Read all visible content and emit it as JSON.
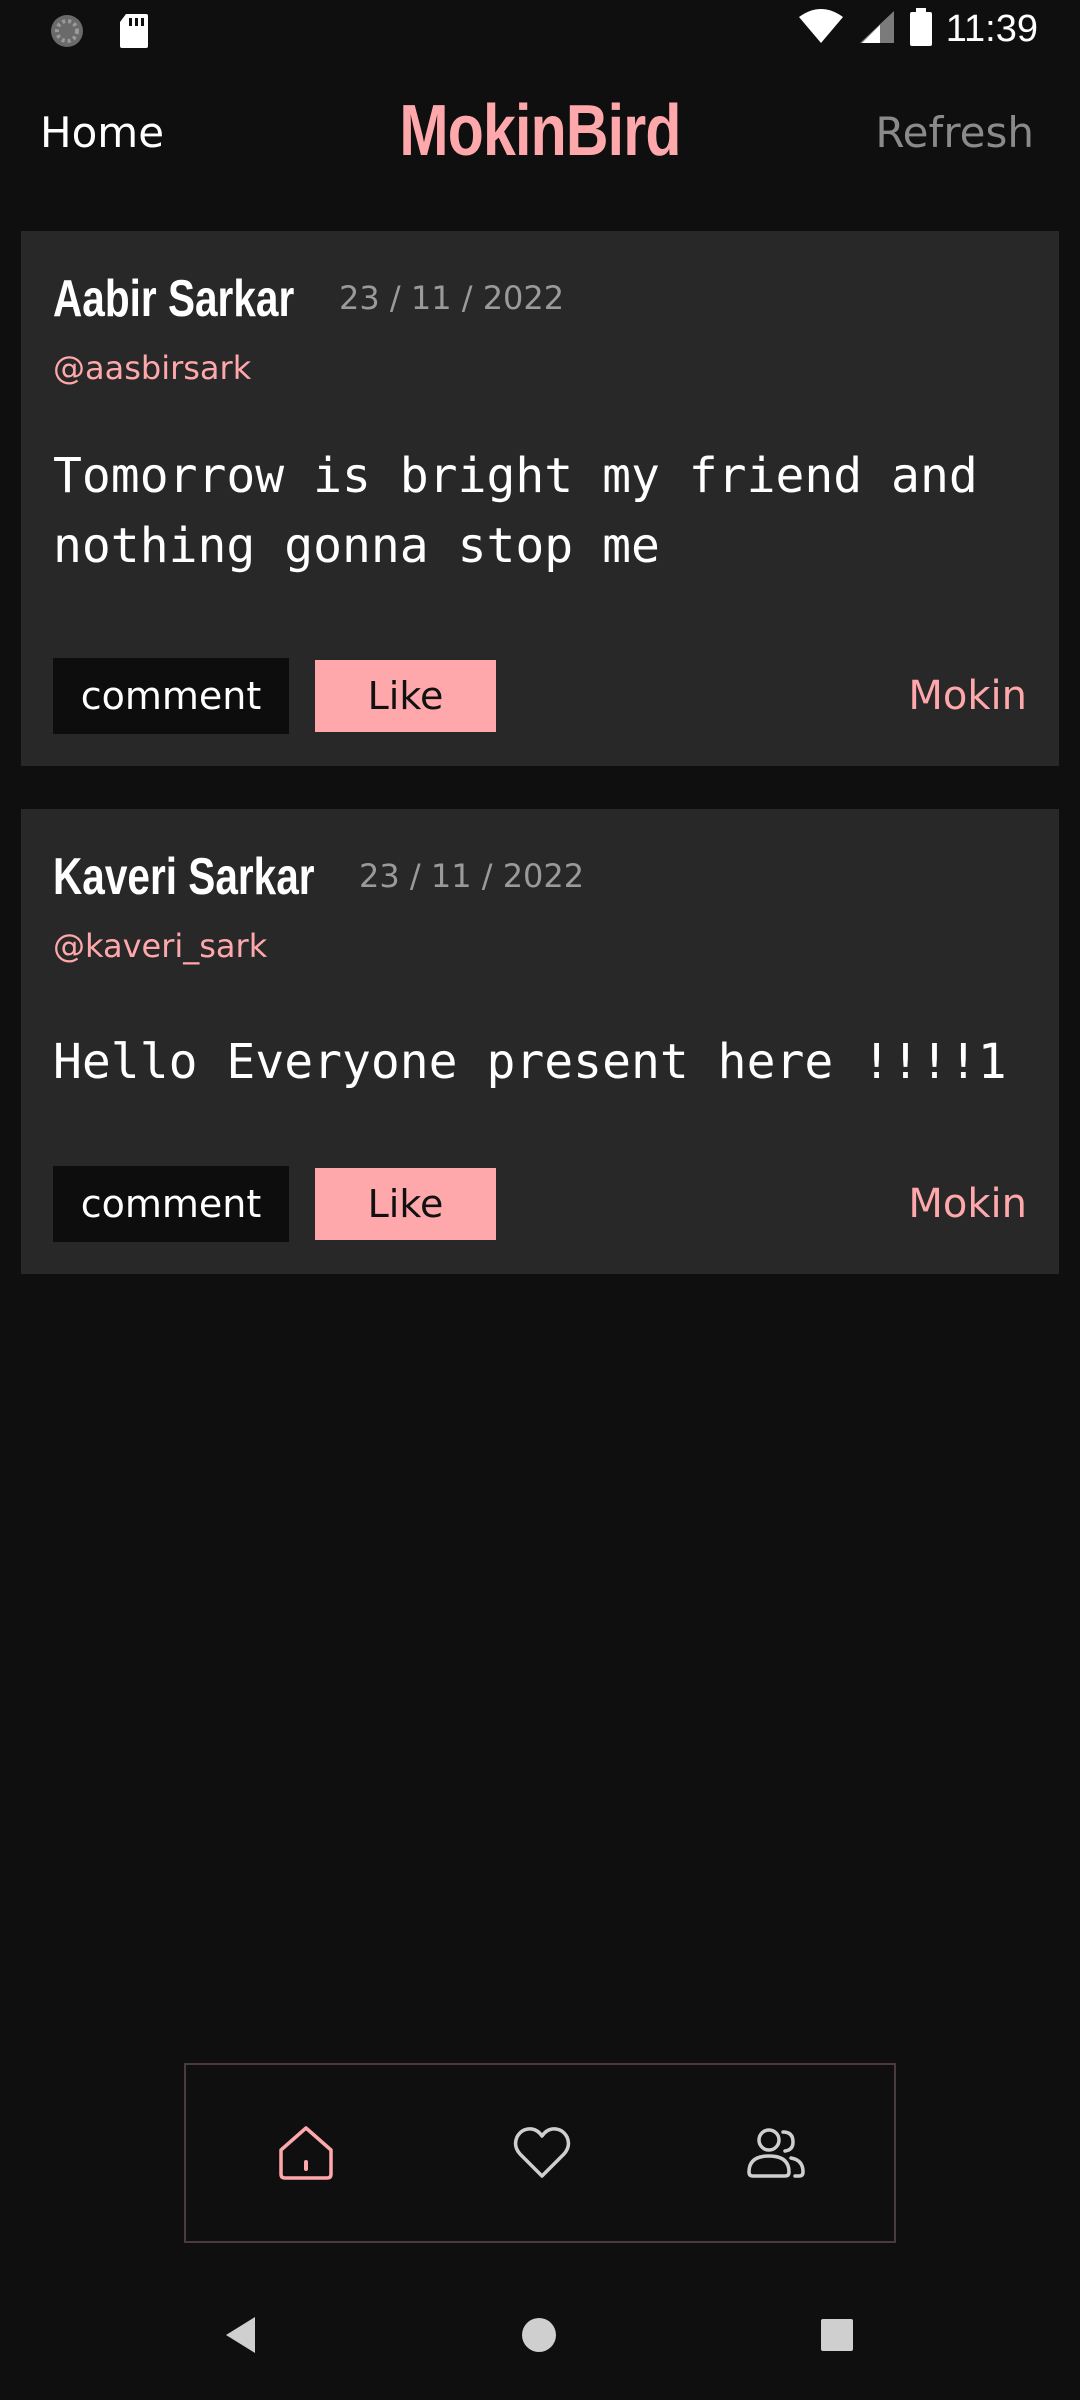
{
  "status_bar": {
    "time": "11:39",
    "icons": [
      "loading-icon",
      "sd-card-icon",
      "wifi-icon",
      "signal-icon",
      "battery-icon"
    ]
  },
  "header": {
    "home_label": "Home",
    "title": "MokinBird",
    "refresh_label": "Refresh"
  },
  "colors": {
    "background": "#0f0f0f",
    "card": "#282828",
    "accent": "#ffa8ab",
    "muted": "#9a9a9a"
  },
  "posts": [
    {
      "author": "Aabir Sarkar",
      "date": "23 / 11 / 2022",
      "handle": "@aasbirsark",
      "body": "Tomorrow is bright my friend and nothing gonna stop me",
      "comment_label": "comment",
      "like_label": "Like",
      "mokin_label": "Mokin"
    },
    {
      "author": "Kaveri Sarkar",
      "date": "23 / 11 / 2022",
      "handle": "@kaveri_sark",
      "body": "Hello Everyone present here !!!!1",
      "comment_label": "comment",
      "like_label": "Like",
      "mokin_label": "Mokin"
    }
  ],
  "tab_bar": {
    "tabs": [
      {
        "icon": "home-icon",
        "active": true
      },
      {
        "icon": "heart-icon",
        "active": false
      },
      {
        "icon": "users-icon",
        "active": false
      }
    ]
  },
  "system_nav": {
    "icons": [
      "back-icon",
      "home-circle-icon",
      "recents-icon"
    ]
  }
}
